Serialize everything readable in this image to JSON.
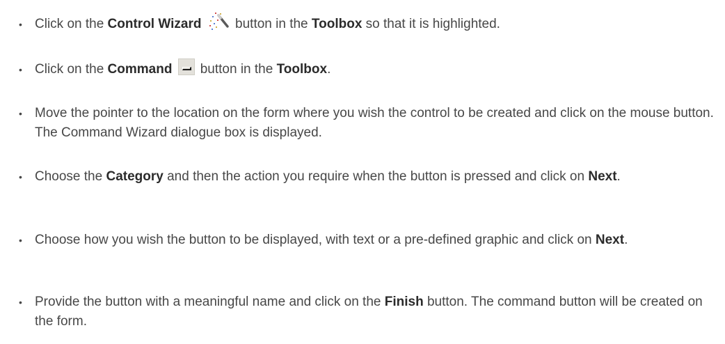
{
  "steps": [
    {
      "p1": "Click on the ",
      "b1": "Control Wizard",
      "icon": "control-wizard-magic-wand-icon",
      "p2": " button in the ",
      "b2": "Toolbox",
      "p3": " so that it is highlighted."
    },
    {
      "p1": "Click on the ",
      "b1": "Command",
      "icon": "command-button-icon",
      "p2": "button in the ",
      "b2": "Toolbox",
      "p3": "."
    },
    {
      "p1": "Move the pointer to the location on the form where you wish the control to be created and click on the mouse button. The Command Wizard dialogue box is displayed."
    },
    {
      "p1": "Choose the ",
      "b1": "Category",
      "p2": " and then the action you require when the button is pressed and click on ",
      "b2": "Next",
      "p3": "."
    },
    {
      "p1": "Choose how you wish the button to be displayed, with text or a pre-defined graphic and click on ",
      "b1": "Next",
      "p2": "."
    },
    {
      "p1": "Provide the button with a meaningful name and click on the ",
      "b1": "Finish",
      "p2": " button. The command button will be created on the form."
    }
  ],
  "bullet_char": "•",
  "colors": {
    "text": "#474747",
    "bold_text": "#2b2b2b",
    "background": "#ffffff"
  }
}
